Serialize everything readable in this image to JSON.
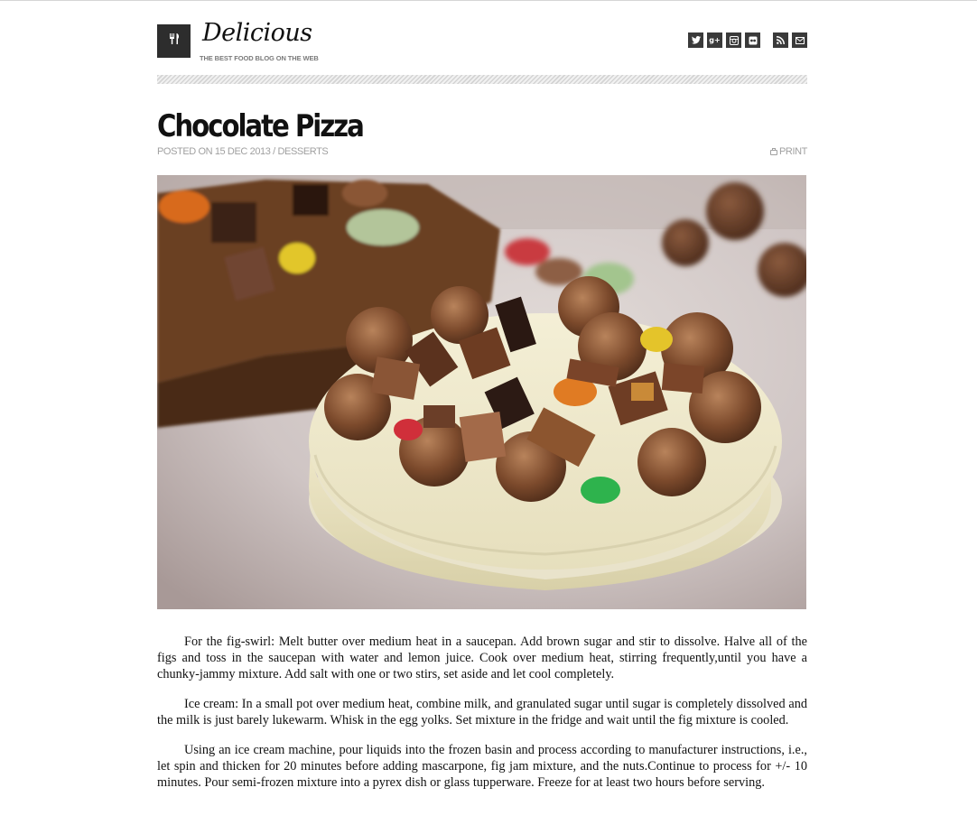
{
  "site": {
    "title": "Delicious",
    "tagline": "THE BEST FOOD BLOG ON THE WEB",
    "logo_icon": "fork-knife-icon"
  },
  "social": [
    {
      "name": "twitter-icon",
      "glyph": "t"
    },
    {
      "name": "google-plus-icon",
      "glyph": "g+"
    },
    {
      "name": "instagram-icon",
      "glyph": "◘"
    },
    {
      "name": "flickr-icon",
      "glyph": "••"
    },
    {
      "name": "rss-icon",
      "glyph": "≋"
    },
    {
      "name": "email-icon",
      "glyph": "✉"
    }
  ],
  "post": {
    "title": "Chocolate Pizza",
    "meta_prefix": "Posted on",
    "date": "15 Dec 2013",
    "separator": " / ",
    "category": "Desserts",
    "print_label": "PRINT",
    "image_alt": "Chocolate Pizza",
    "paragraphs": [
      "For the fig-swirl: Melt butter over medium heat in a saucepan. Add brown sugar and stir to dissolve. Halve all of the figs and toss in the saucepan with water and lemon juice. Cook over medium heat, stirring frequently,until you have a chunky-jammy mixture. Add salt with one or two stirs, set aside and let cool completely.",
      "Ice cream: In a small pot over medium heat, combine milk, and granulated sugar until sugar is completely dissolved and the milk is just barely lukewarm. Whisk in the egg yolks. Set mixture in the fridge and wait until the fig mixture is cooled.",
      "Using an ice cream machine, pour liquids into the frozen basin and process according to manufacturer instructions, i.e., let spin and thicken for 20 minutes before adding mascarpone, fig jam mixture, and the nuts.Continue to process for +/- 10 minutes. Pour semi-frozen mixture into a pyrex dish or glass tupperware. Freeze for at least two hours before serving."
    ]
  },
  "colors": {
    "dark_icon_bg": "#2d2d2d",
    "meta_text": "#a0a0a0",
    "stripe": "#d4d4d4"
  }
}
